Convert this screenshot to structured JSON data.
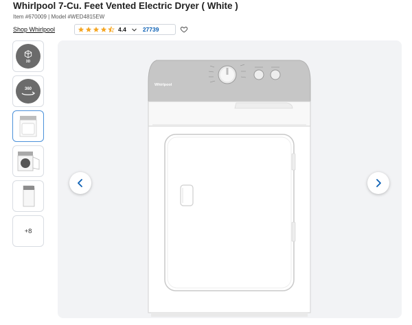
{
  "product": {
    "title": "Whirlpool 7-Cu. Feet Vented Electric Dryer ( White )",
    "subline": "Item #670009 | Model #WED4815EW",
    "brand_link": "Shop Whirlpool",
    "brand_on_appliance": "Whirlpool"
  },
  "rating": {
    "value": "4.4",
    "stars": 4.4,
    "star_color": "#f5a623",
    "review_count": "27739"
  },
  "thumbnails": [
    {
      "type": "3d",
      "label": "3D",
      "icon": "cube-3d-icon"
    },
    {
      "type": "360",
      "label": "360",
      "icon": "rotate-360-icon"
    },
    {
      "type": "image",
      "view": "front",
      "active": true
    },
    {
      "type": "image",
      "view": "door-open"
    },
    {
      "type": "image",
      "view": "side"
    },
    {
      "type": "more",
      "label": "+8"
    }
  ],
  "icons": {
    "favorite": "heart-outline-icon",
    "prev": "chevron-left-icon",
    "next": "chevron-right-icon",
    "dropdown": "chevron-down-icon"
  },
  "colors": {
    "accent": "#0a5fb4",
    "active_thumb_border": "#4a90d9",
    "stage_background": "#f2f3f5"
  }
}
